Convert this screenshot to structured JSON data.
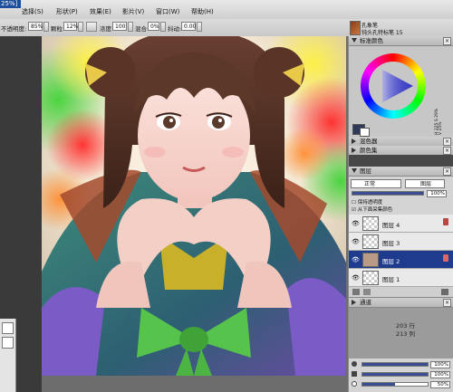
{
  "window": {
    "title_fragment": "25%]"
  },
  "menu": {
    "items": [
      "选择(S)",
      "形状(P)",
      "效果(E)",
      "影片(V)",
      "窗口(W)",
      "帮助(H)"
    ]
  },
  "options": {
    "opacity_label": "不透明度:",
    "opacity_value": "85%",
    "feather_label": "颗粒:",
    "feather_value": "12%",
    "density_label": "浓度:",
    "density_value": "100",
    "blend_label": "混合:",
    "blend_value": "0%",
    "jitter_label": "抖动:",
    "jitter_value": "0.00"
  },
  "brush": {
    "category": "孔象笔",
    "variant": "钝头孔特标笔 15"
  },
  "panels": {
    "standard_colors": "标准颜色",
    "mixer": "混色器",
    "color_set": "颜色集",
    "layers": "图层",
    "channels": "通道"
  },
  "color": {
    "hue_readout": "H 225",
    "sat_readout": "S 29%",
    "val_readout": "V 25%",
    "main_color": "#2f3a58",
    "back_color": "#ffffff"
  },
  "layers": {
    "composite_method": "正常",
    "blend": "图层",
    "opacity_value": "100%",
    "preserve_label": "保持透明度",
    "pick_label": "从下面采集颜色",
    "items": [
      {
        "name": "图层 4",
        "selected": false
      },
      {
        "name": "图层 3",
        "selected": false
      },
      {
        "name": "图层 2",
        "selected": true
      },
      {
        "name": "图层 1",
        "selected": false
      }
    ]
  },
  "navigator": {
    "row_label": "203 行",
    "col_label": "213 列"
  },
  "bottom_sliders": [
    {
      "value": "100%",
      "fraction": 1.0
    },
    {
      "value": "100%",
      "fraction": 1.0
    },
    {
      "value": "50%",
      "fraction": 0.5
    }
  ]
}
